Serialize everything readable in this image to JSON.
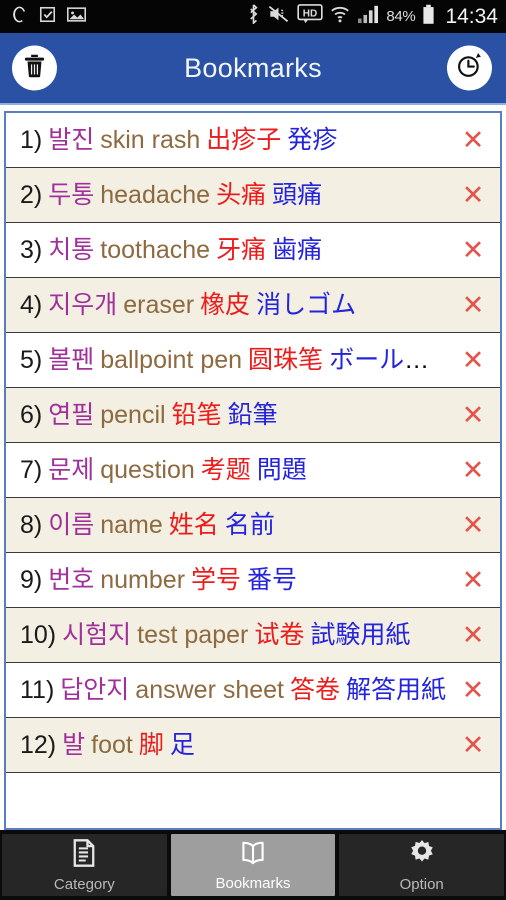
{
  "status_bar": {
    "time": "14:34",
    "battery_percent": "84%",
    "left_icons": [
      "opera-logo-icon",
      "document-check-icon",
      "image-icon"
    ],
    "right_icons": [
      "bluetooth-icon",
      "mute-vibrate-icon",
      "hd-badge-icon",
      "wifi-icon",
      "signal-bars-icon",
      "battery-icon"
    ]
  },
  "header": {
    "title": "Bookmarks",
    "left_button": "delete-all-button",
    "left_icon": "trash-icon",
    "right_button": "history-button",
    "right_icon": "clock-add-icon",
    "background_color": "#2a51a3"
  },
  "colors": {
    "korean": "#a0309a",
    "english": "#8d6a3f",
    "chinese": "#ee1b1b",
    "japanese": "#2424dd",
    "delete_x": "#e2544c",
    "row_even_bg": "#f3efe2",
    "row_odd_bg": "#ffffff",
    "list_border": "#5a7ec0"
  },
  "list": {
    "delete_symbol": "✕",
    "rows": [
      {
        "num": "1)",
        "ko": "발진",
        "en": "skin rash",
        "zh": "出疹子",
        "ja": "発疹"
      },
      {
        "num": "2)",
        "ko": "두통",
        "en": "headache",
        "zh": "头痛",
        "ja": "頭痛"
      },
      {
        "num": "3)",
        "ko": "치통",
        "en": "toothache",
        "zh": "牙痛",
        "ja": "歯痛"
      },
      {
        "num": "4)",
        "ko": "지우개",
        "en": "eraser",
        "zh": "橡皮",
        "ja": "消しゴム"
      },
      {
        "num": "5)",
        "ko": "볼펜",
        "en": "ballpoint pen",
        "zh": "圆珠笔",
        "ja": "ボールペン"
      },
      {
        "num": "6)",
        "ko": "연필",
        "en": "pencil",
        "zh": "铅笔",
        "ja": "鉛筆"
      },
      {
        "num": "7)",
        "ko": "문제",
        "en": "question",
        "zh": "考题",
        "ja": "問題"
      },
      {
        "num": "8)",
        "ko": "이름",
        "en": "name",
        "zh": "姓名",
        "ja": "名前"
      },
      {
        "num": "9)",
        "ko": "번호",
        "en": "number",
        "zh": "学号",
        "ja": "番号"
      },
      {
        "num": "10)",
        "ko": "시험지",
        "en": "test paper",
        "zh": "试卷",
        "ja": "試験用紙"
      },
      {
        "num": "11)",
        "ko": "답안지",
        "en": "answer sheet",
        "zh": "答卷",
        "ja": "解答用紙"
      },
      {
        "num": "12)",
        "ko": "발",
        "en": "foot",
        "zh": "脚",
        "ja": "足"
      }
    ]
  },
  "nav": {
    "items": [
      {
        "label": "Category",
        "icon": "document-lines-icon",
        "active": false
      },
      {
        "label": "Bookmarks",
        "icon": "open-book-icon",
        "active": true
      },
      {
        "label": "Option",
        "icon": "gear-icon",
        "active": false
      }
    ]
  }
}
